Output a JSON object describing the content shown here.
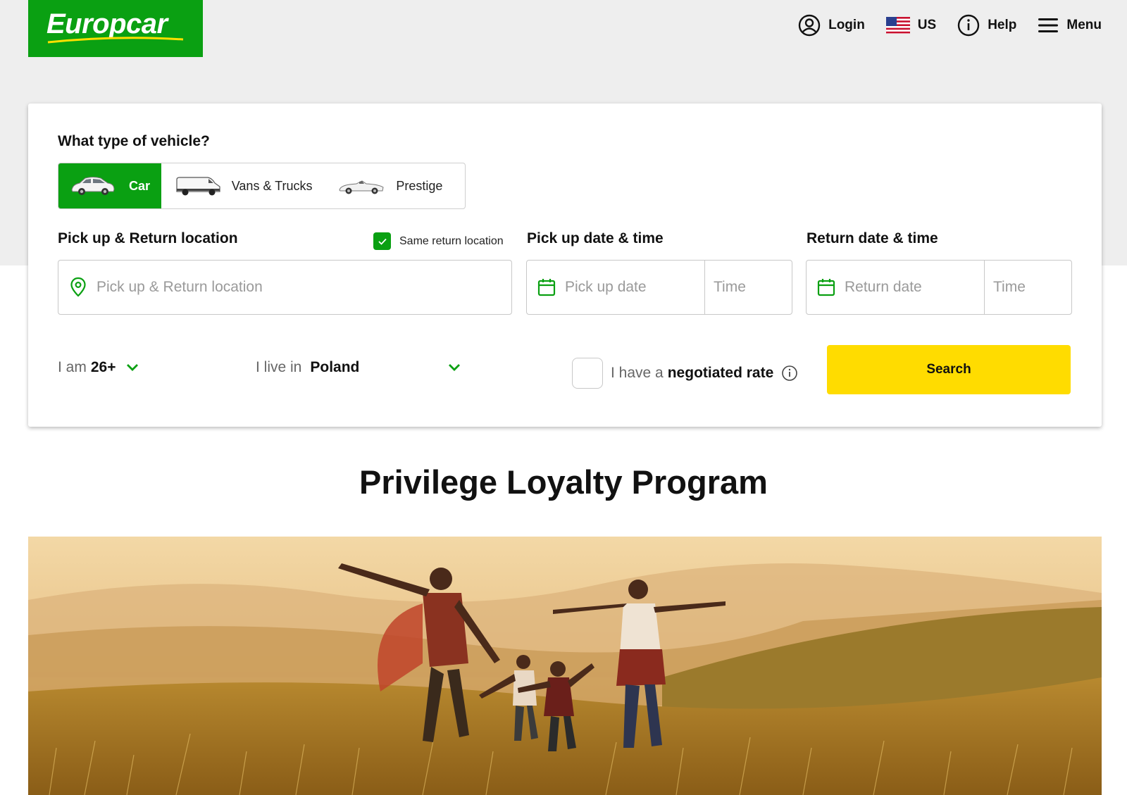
{
  "brand": {
    "name": "Europcar",
    "color": "#0aa012"
  },
  "nav": {
    "login": "Login",
    "country": "US",
    "help": "Help",
    "menu": "Menu"
  },
  "vehicle": {
    "question": "What type of vehicle?",
    "tabs": [
      {
        "label": "Car",
        "active": true
      },
      {
        "label": "Vans & Trucks",
        "active": false
      },
      {
        "label": "Prestige",
        "active": false
      }
    ]
  },
  "location": {
    "label": "Pick up & Return location",
    "same_return_label": "Same return location",
    "same_return_checked": true,
    "placeholder": "Pick up & Return location"
  },
  "pickup": {
    "label": "Pick up date & time",
    "date_placeholder": "Pick up date",
    "time_placeholder": "Time"
  },
  "return": {
    "label": "Return date & time",
    "date_placeholder": "Return date",
    "time_placeholder": "Time"
  },
  "driver": {
    "age_prefix": "I am",
    "age_value": "26+",
    "residence_prefix": "I live in",
    "residence_value": "Poland"
  },
  "negotiated": {
    "prefix": "I have a",
    "emphasis": "negotiated rate",
    "checked": false
  },
  "search_label": "Search",
  "promo": {
    "title": "Privilege Loyalty Program"
  },
  "colors": {
    "accent": "#0aa012",
    "cta": "#ffdc00",
    "band": "#eeeeee"
  }
}
